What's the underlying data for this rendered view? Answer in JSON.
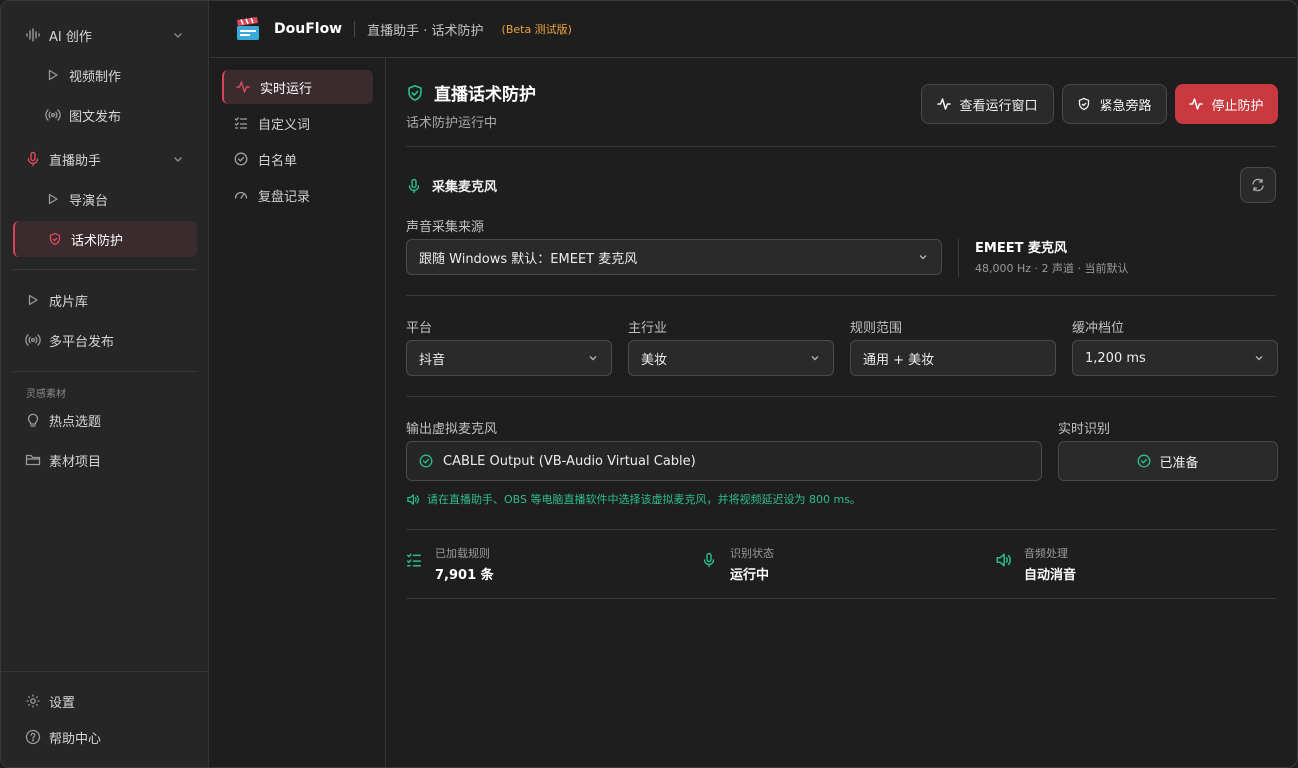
{
  "sidebar": {
    "items": [
      {
        "label": "AI 创作"
      },
      {
        "label": "视频制作"
      },
      {
        "label": "图文发布"
      },
      {
        "label": "直播助手"
      },
      {
        "label": "导演台"
      },
      {
        "label": "话术防护"
      },
      {
        "label": "成片库"
      },
      {
        "label": "多平台发布"
      },
      {
        "label": "热点选题"
      },
      {
        "label": "素材项目"
      },
      {
        "label": "设置"
      },
      {
        "label": "帮助中心"
      }
    ],
    "section_label": "灵感素材"
  },
  "topbar": {
    "app_name": "DouFlow",
    "breadcrumb": "直播助手 · 话术防护",
    "beta": "(Beta 测试版)"
  },
  "subnav": {
    "items": [
      {
        "label": "实时运行"
      },
      {
        "label": "自定义词"
      },
      {
        "label": "白名单"
      },
      {
        "label": "复盘记录"
      }
    ]
  },
  "main": {
    "title": "直播话术防护",
    "subtitle": "话术防护运行中",
    "buttons": {
      "view_window": "查看运行窗口",
      "bypass": "紧急旁路",
      "stop": "停止防护"
    },
    "mic_section": "采集麦克风",
    "source_label": "声音采集来源",
    "source_value": "跟随 Windows 默认：EMEET 麦克风",
    "device_name": "EMEET 麦克风",
    "device_meta": "48,000 Hz · 2 声道 · 当前默认",
    "platform_label": "平台",
    "platform_value": "抖音",
    "industry_label": "主行业",
    "industry_value": "美妆",
    "scope_label": "规则范围",
    "scope_value": "通用 + 美妆",
    "buffer_label": "缓冲档位",
    "buffer_value": "1,200 ms",
    "output_label": "输出虚拟麦克风",
    "output_value": "CABLE Output (VB-Audio Virtual Cable)",
    "recog_label": "实时识别",
    "recog_value": "已准备",
    "hint": "请在直播助手、OBS 等电脑直播软件中选择该虚拟麦克风，并将视频延迟设为 800 ms。",
    "stats": [
      {
        "label": "已加载规则",
        "value": "7,901 条"
      },
      {
        "label": "识别状态",
        "value": "运行中"
      },
      {
        "label": "音频处理",
        "value": "自动消音"
      }
    ]
  },
  "colors": {
    "accent": "#d6435a",
    "success": "#2bbf8a",
    "danger_button": "#c93a40",
    "beta": "#e8a33a"
  }
}
